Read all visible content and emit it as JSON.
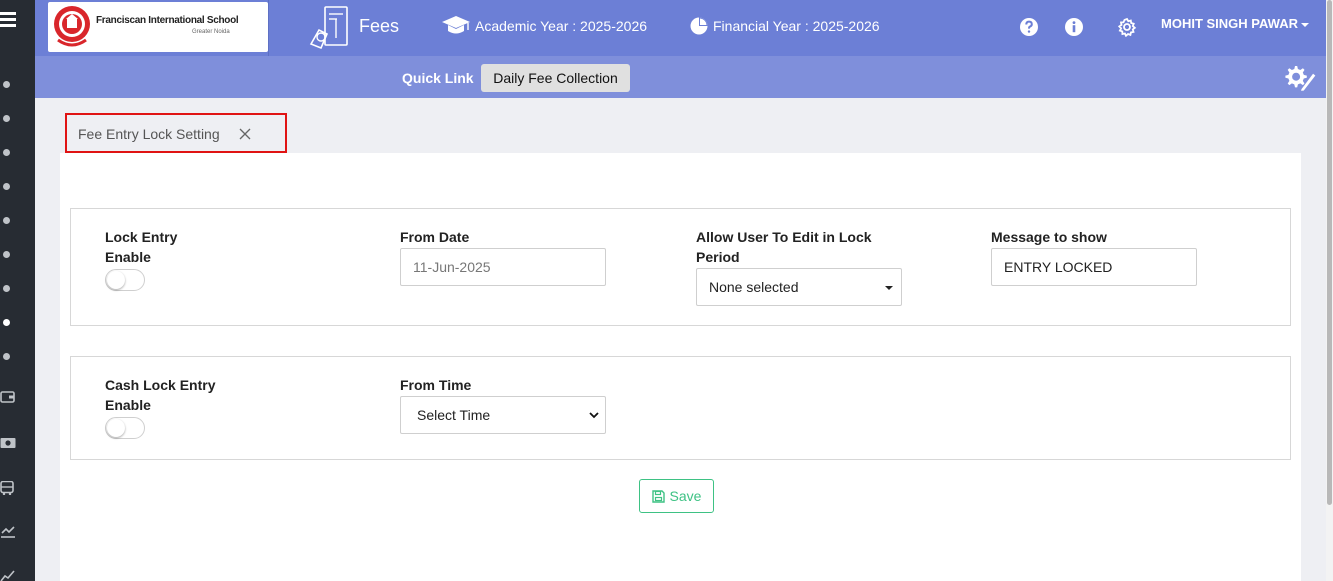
{
  "header": {
    "school_name": "Franciscan International School",
    "school_sub": "Greater Noida",
    "module_title": "Fees",
    "academic_year": "Academic Year : 2025-2026",
    "financial_year": "Financial Year : 2025-2026",
    "user_name": "MOHIT SINGH PAWAR"
  },
  "quick_link": {
    "label": "Quick Link",
    "button": "Daily Fee Collection"
  },
  "tab": {
    "label": "Fee Entry Lock Setting"
  },
  "form": {
    "lock_entry_label_1": "Lock Entry",
    "lock_entry_label_2": "Enable",
    "lock_entry_enabled": false,
    "from_date_label": "From Date",
    "from_date_value": "11-Jun-2025",
    "allow_edit_label_1": "Allow User To Edit in Lock",
    "allow_edit_label_2": "Period",
    "allow_edit_value": "None selected",
    "message_label": "Message to show",
    "message_value": "ENTRY LOCKED",
    "cash_lock_label_1": "Cash Lock Entry",
    "cash_lock_label_2": "Enable",
    "cash_lock_enabled": false,
    "from_time_label": "From Time",
    "from_time_value": "Select Time",
    "save_label": "Save"
  },
  "colors": {
    "header_bg": "#6c7fd6",
    "quickbar_bg": "#7f8fdb",
    "rail_bg": "#272c33",
    "save_green": "#3ec284",
    "highlight_red": "#e01313"
  },
  "icons": {
    "menu": "hamburger-icon",
    "fees": "fees-receipt-icon",
    "academic": "graduation-cap-icon",
    "financial": "pie-chart-icon",
    "help": "question-circle-icon",
    "info": "info-circle-icon",
    "settings": "gear-icon",
    "quick_settings": "gear-pen-icon",
    "close_tab": "close-icon",
    "save": "floppy-disk-icon"
  }
}
